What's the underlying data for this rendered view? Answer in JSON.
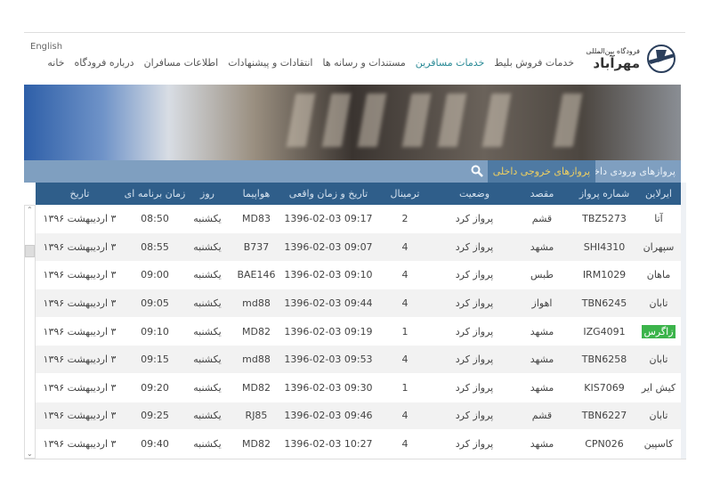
{
  "header": {
    "language_link": "English",
    "logo_small": "فرودگاه بین‌المللی",
    "logo_big": "مهرآباد",
    "menu": [
      {
        "label": "خانه"
      },
      {
        "label": "درباره فرودگاه"
      },
      {
        "label": "اطلاعات مسافران"
      },
      {
        "label": "انتقادات و پیشنهادات"
      },
      {
        "label": "مستندات و رسانه ها"
      },
      {
        "label": "خدمات مسافرین",
        "active": true
      },
      {
        "label": "خدمات فروش بلیط"
      }
    ],
    "accent_color": "#2a8a96"
  },
  "tabs": [
    {
      "label": "پروازهای ورودی داخلی"
    },
    {
      "label": "پروازهای خروجی داخلی",
      "active": true
    }
  ],
  "search_icon": "search-icon",
  "table": {
    "columns": [
      "ایرلاین",
      "شماره پرواز",
      "مقصد",
      "وضعیت",
      "ترمینال",
      "تاریخ و زمان واقعی",
      "هواپیما",
      "روز",
      "زمان برنامه ای",
      "تاریخ"
    ],
    "rows": [
      [
        "آتا",
        "TBZ5273",
        "قشم",
        "پرواز کرد",
        "2",
        "09:17 1396-02-03",
        "MD83",
        "یکشنبه",
        "08:50",
        "۳ اردیبهشت ۱۳۹۶"
      ],
      [
        "سپهران",
        "SHI4310",
        "مشهد",
        "پرواز کرد",
        "4",
        "09:07 1396-02-03",
        "B737",
        "یکشنبه",
        "08:55",
        "۳ اردیبهشت ۱۳۹۶"
      ],
      [
        "ماهان",
        "IRM1029",
        "طبس",
        "پرواز کرد",
        "4",
        "09:10 1396-02-03",
        "BAE146",
        "یکشنبه",
        "09:00",
        "۳ اردیبهشت ۱۳۹۶"
      ],
      [
        "تابان",
        "TBN6245",
        "اهواز",
        "پرواز کرد",
        "4",
        "09:44 1396-02-03",
        "md88",
        "یکشنبه",
        "09:05",
        "۳ اردیبهشت ۱۳۹۶"
      ],
      [
        "زاگرس",
        "IZG4091",
        "مشهد",
        "پرواز کرد",
        "1",
        "09:19 1396-02-03",
        "MD82",
        "یکشنبه",
        "09:10",
        "۳ اردیبهشت ۱۳۹۶"
      ],
      [
        "تابان",
        "TBN6258",
        "مشهد",
        "پرواز کرد",
        "4",
        "09:53 1396-02-03",
        "md88",
        "یکشنبه",
        "09:15",
        "۳ اردیبهشت ۱۳۹۶"
      ],
      [
        "کیش ایر",
        "KIS7069",
        "مشهد",
        "پرواز کرد",
        "1",
        "09:30 1396-02-03",
        "MD82",
        "یکشنبه",
        "09:20",
        "۳ اردیبهشت ۱۳۹۶"
      ],
      [
        "تابان",
        "TBN6227",
        "قشم",
        "پرواز کرد",
        "4",
        "09:46 1396-02-03",
        "RJ85",
        "یکشنبه",
        "09:25",
        "۳ اردیبهشت ۱۳۹۶"
      ],
      [
        "کاسپین",
        "CPN026",
        "مشهد",
        "پرواز کرد",
        "4",
        "10:27 1396-02-03",
        "MD82",
        "یکشنبه",
        "09:40",
        "۳ اردیبهشت ۱۳۹۶"
      ]
    ],
    "highlighted_cell": {
      "row": 4,
      "col": 0,
      "color": "#3cb44b"
    }
  }
}
